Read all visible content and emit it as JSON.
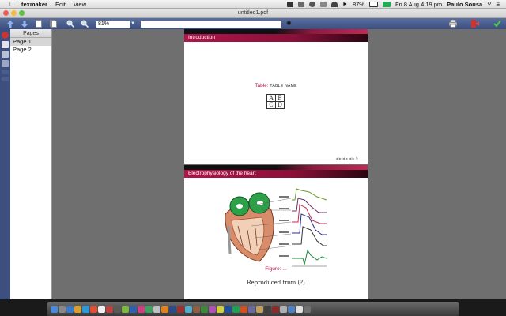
{
  "menubar": {
    "apple": "",
    "app_name": "texmaker",
    "menus": [
      "Edit",
      "View"
    ],
    "battery": "87%",
    "datetime": "Fri 8 Aug  4:19 pm",
    "user": "Paulo Sousa"
  },
  "window": {
    "title": "untitled1.pdf"
  },
  "toolbar": {
    "zoom_value": "81%",
    "search_value": ""
  },
  "pages_panel": {
    "header": "Pages",
    "items": [
      {
        "label": "Page 1"
      },
      {
        "label": "Page 2"
      }
    ]
  },
  "slide1": {
    "frame_title": "Introduction",
    "table_label": "Table:",
    "table_name": "TABLE NAME",
    "table_cells": [
      [
        "A",
        "B"
      ],
      [
        "C",
        "D"
      ]
    ]
  },
  "slide2": {
    "frame_title": "Electrophysiology of the heart",
    "figure_label": "Figure:",
    "figure_text": "...",
    "reproduced": "Reproduced from (?)"
  },
  "colors": {
    "beamer_accent": "#b0154a",
    "toolbar_bg": "#3c4f7e",
    "viewer_bg": "#6f6f6f"
  }
}
